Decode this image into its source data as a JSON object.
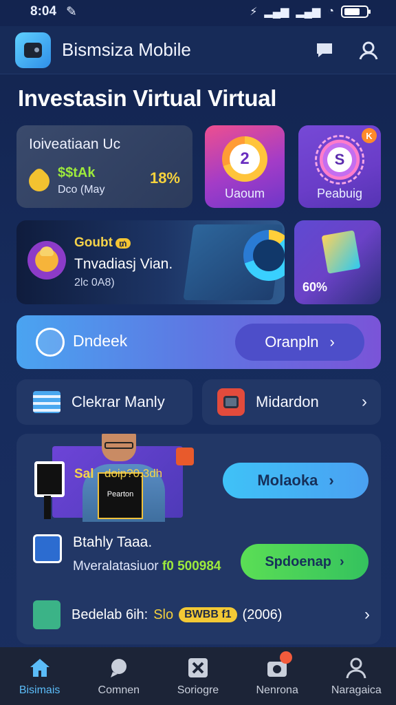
{
  "status_bar": {
    "time": "8:04"
  },
  "header": {
    "title": "Bismsiza Mobile"
  },
  "page_title": "Investasin Virtual Virtual",
  "investment_card": {
    "title": "Ioiveatiaan Uc",
    "amount": "$$tAk",
    "subtitle": "Dco (May",
    "percent": "18%"
  },
  "tiles": [
    {
      "label": "Uaoum",
      "ring_value": "2"
    },
    {
      "label": "Peabuig",
      "ring_value": "S",
      "badge": "K"
    }
  ],
  "banner": {
    "line1": "Goubt",
    "line1_badge": "₥",
    "line2": "Tnvadiasj Vian.",
    "line3": "2lc 0A8)"
  },
  "iso_card": {
    "percent": "60%"
  },
  "cta": {
    "label": "Dndeek",
    "button": "Oranpln"
  },
  "list_row": [
    {
      "label": "Clekrar Manly"
    },
    {
      "label": "Midardon"
    }
  ],
  "panel": {
    "promo_text": "Sal",
    "promo_text2": "doip?0.3dh",
    "screen_tag": "Pearton",
    "button_blue": "Molaoka",
    "row_b_title": "Btahly Taaa.",
    "row_b_sub": "Mveralatasiuor",
    "row_b_value": "f0 500984",
    "button_green": "Spdoenap",
    "row_c_text": "Bedelab 6ih:",
    "row_c_slo": "Slo",
    "row_c_badge": "BWBB f1",
    "row_c_tail": "(2006)"
  },
  "bottom_nav": [
    {
      "label": "Bisimais",
      "active": true
    },
    {
      "label": "Comnen",
      "active": false
    },
    {
      "label": "Soriogre",
      "active": false
    },
    {
      "label": "Nenrona",
      "active": false
    },
    {
      "label": "Naragaica",
      "active": false
    }
  ]
}
